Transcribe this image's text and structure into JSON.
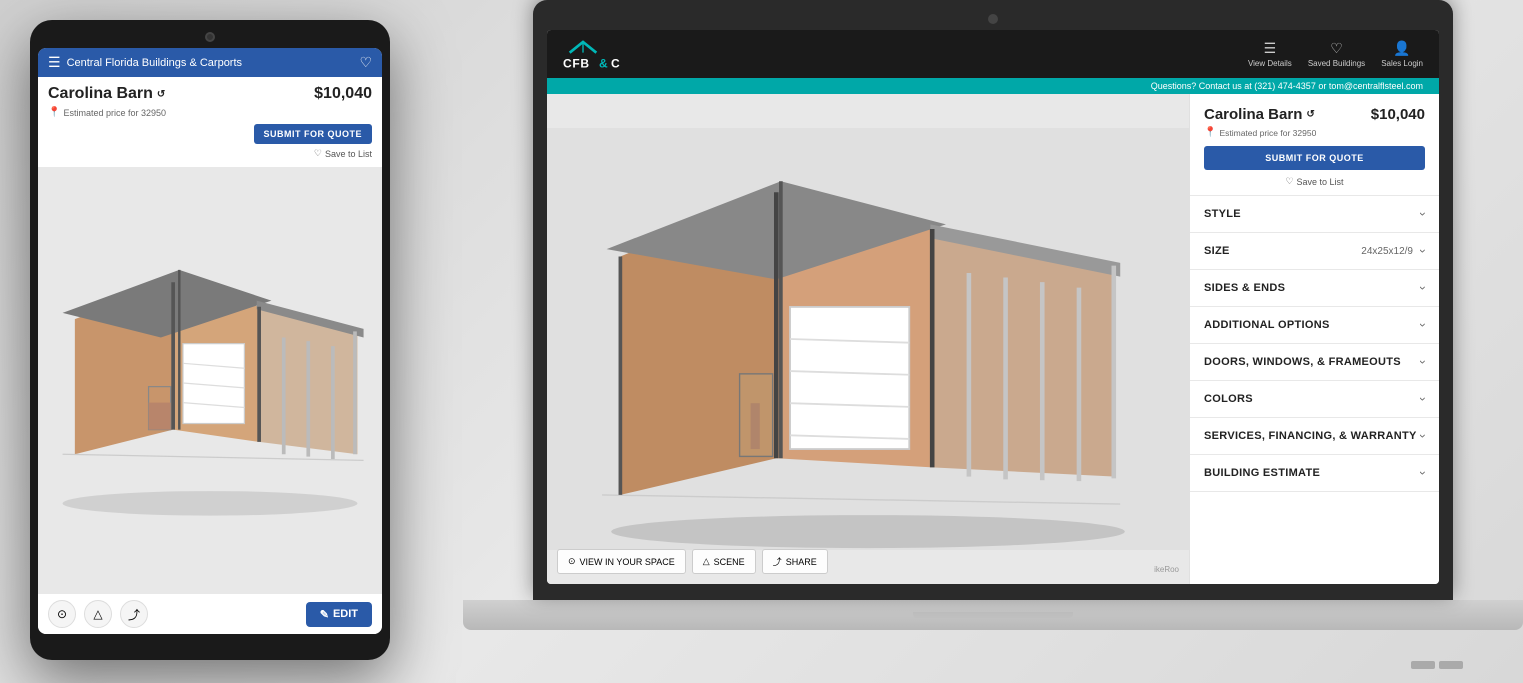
{
  "tablet": {
    "topbar": {
      "title": "Central Florida Buildings & Carports"
    },
    "building_name": "Carolina Barn",
    "price": "$10,040",
    "location_label": "Estimated price for 32950",
    "quote_btn": "SUBMIT FOR QUOTE",
    "save_btn": "Save to List",
    "edit_btn": "EDIT"
  },
  "laptop": {
    "logo": "CFB&C",
    "contact_bar": "Questions? Contact us at (321) 474-4357 or tom@centralflsteel.com",
    "nav": {
      "view_details": "View Details",
      "saved_buildings": "Saved Buildings",
      "sales_login": "Sales Login"
    },
    "panel": {
      "building_name": "Carolina Barn",
      "price": "$10,040",
      "location_label": "Estimated price for 32950",
      "quote_btn": "SUBMIT FOR QUOTE",
      "save_btn": "Save to List",
      "accordion": [
        {
          "label": "STYLE",
          "value": "",
          "has_value": false
        },
        {
          "label": "SIZE",
          "value": "24x25x12/9",
          "has_value": true
        },
        {
          "label": "SIDES & ENDS",
          "value": "",
          "has_value": false
        },
        {
          "label": "ADDITIONAL OPTIONS",
          "value": "",
          "has_value": false
        },
        {
          "label": "DOORS, WINDOWS, & FRAMEOUTS",
          "value": "",
          "has_value": false
        },
        {
          "label": "COLORS",
          "value": "",
          "has_value": false
        },
        {
          "label": "SERVICES, FINANCING, & WARRANTY",
          "value": "",
          "has_value": false
        },
        {
          "label": "BUILDING ESTIMATE",
          "value": "",
          "has_value": false
        }
      ]
    },
    "viewer": {
      "btn_view_space": "VIEW IN YOUR SPACE",
      "btn_scene": "SCENE",
      "btn_share": "SHARE"
    }
  }
}
